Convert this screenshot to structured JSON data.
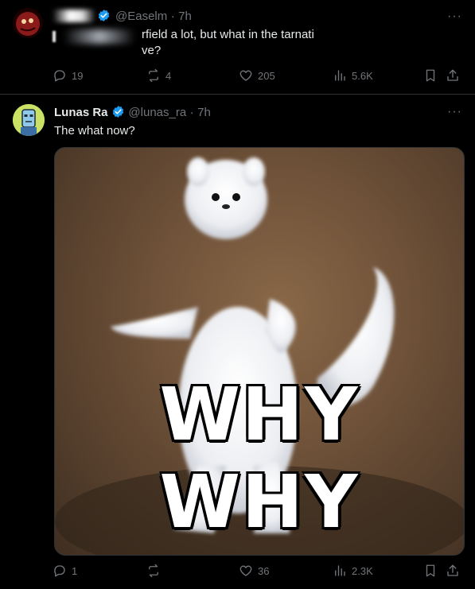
{
  "tweet1": {
    "handle": "@Easelm",
    "sep": "·",
    "time": "7h",
    "text_line1": "rfield a lot, but what in the tarnati",
    "text_line2": "ve?",
    "actions": {
      "replies": "19",
      "reposts": "4",
      "likes": "205",
      "views": "5.6K"
    }
  },
  "tweet2": {
    "name": "Lunas Ra",
    "handle": "@lunas_ra",
    "sep": "·",
    "time": "7h",
    "text": "The what now?",
    "media": {
      "caption_top": "WHY",
      "caption_bottom": "WHY"
    },
    "actions": {
      "replies": "1",
      "reposts": "",
      "likes": "36",
      "views": "2.3K"
    }
  },
  "more_glyph": "···",
  "colors": {
    "background": "#000000",
    "muted": "#71767b",
    "verified": "#1d9bf0"
  }
}
